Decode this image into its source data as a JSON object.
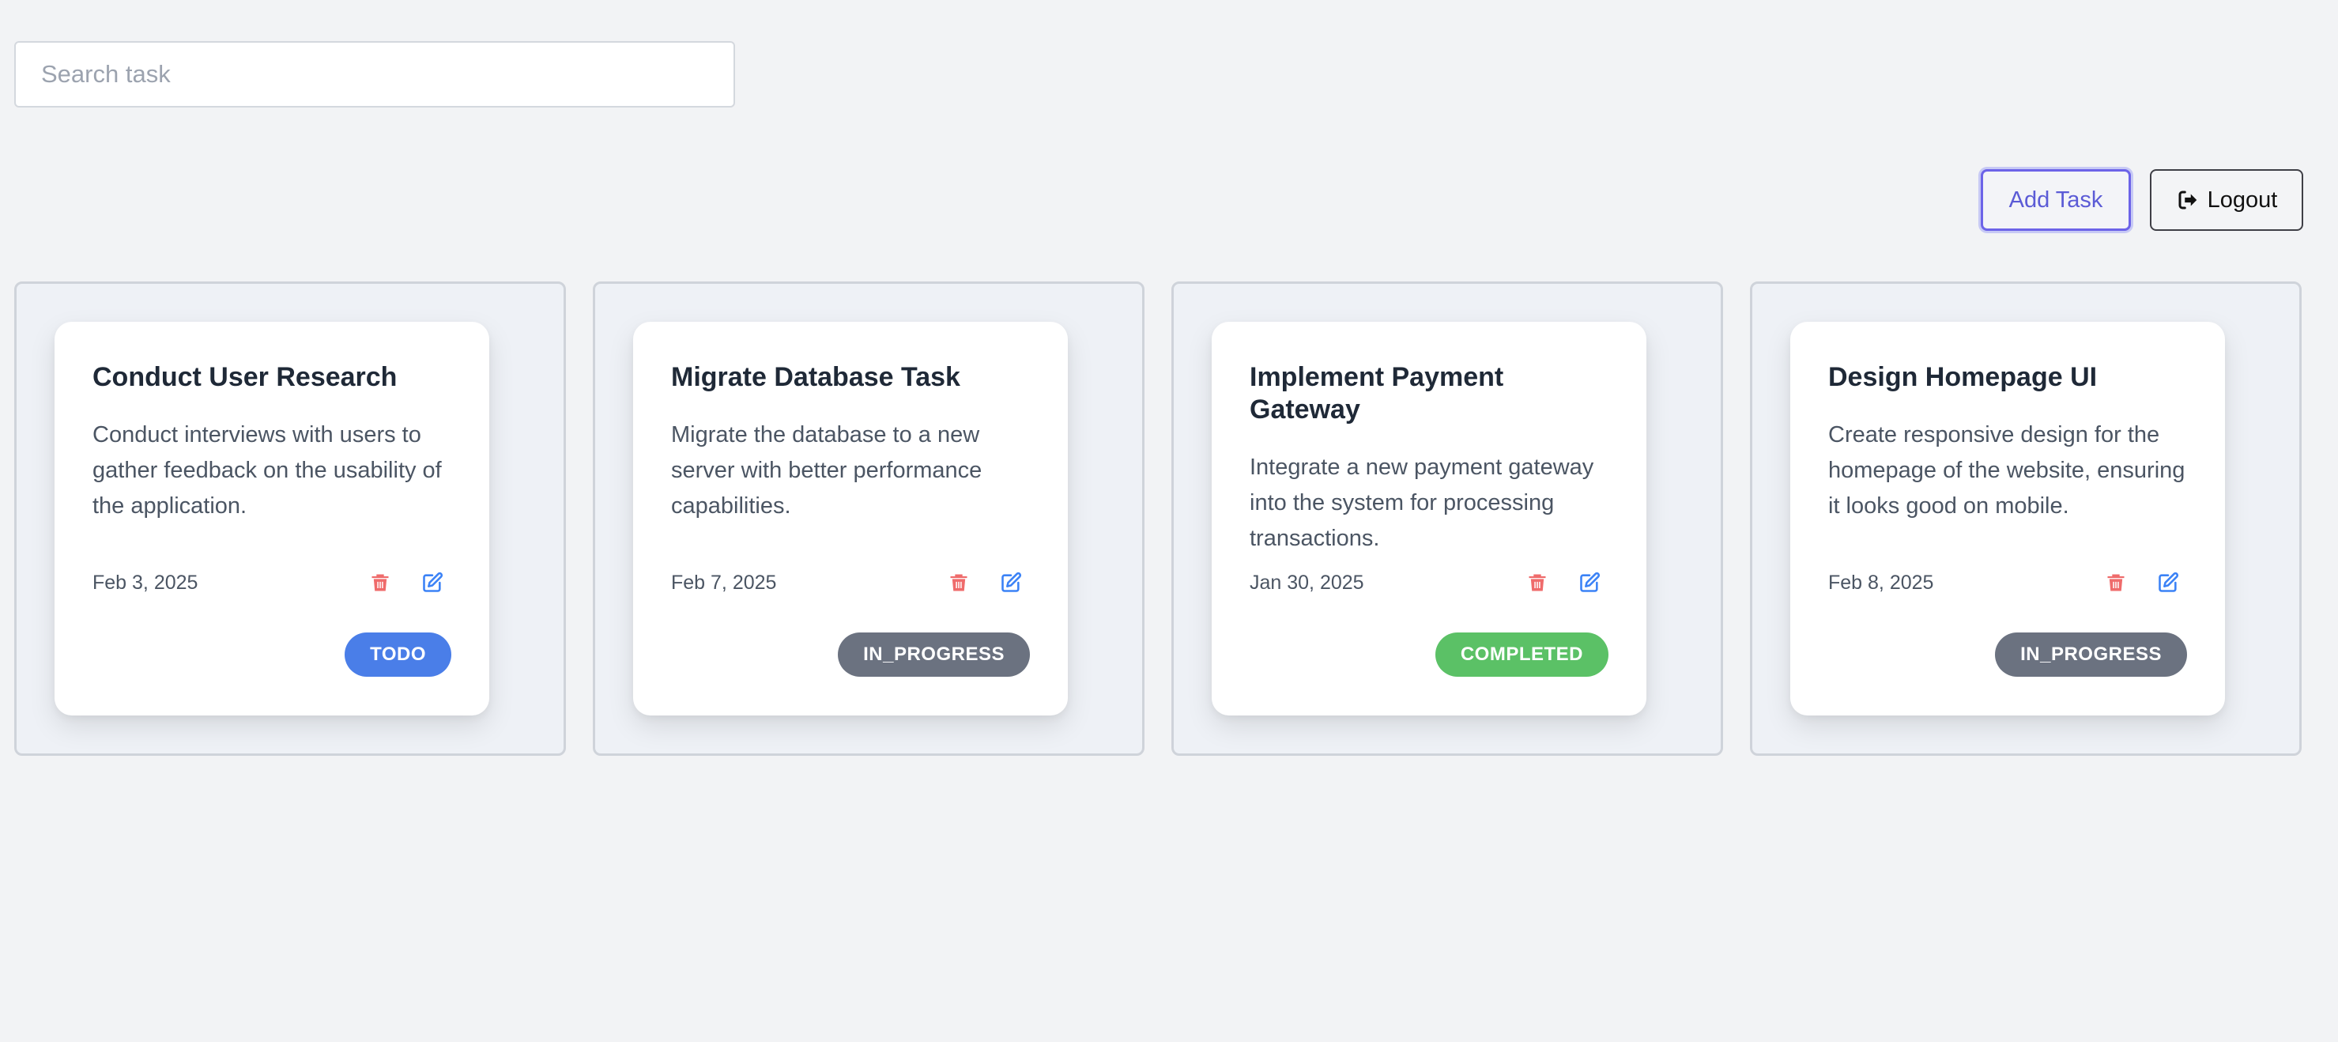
{
  "search": {
    "placeholder": "Search task",
    "value": ""
  },
  "toolbar": {
    "add_label": "Add Task",
    "logout_label": "Logout"
  },
  "status_colors": {
    "TODO": "#4a7ee8",
    "IN_PROGRESS": "#6b7280",
    "COMPLETED": "#5bc166"
  },
  "tasks": [
    {
      "title": "Conduct User Research",
      "description": "Conduct interviews with users to gather feedback on the usability of the application.",
      "date": "Feb 3, 2025",
      "status": "TODO"
    },
    {
      "title": "Migrate Database Task",
      "description": "Migrate the database to a new server with better performance capabilities.",
      "date": "Feb 7, 2025",
      "status": "IN_PROGRESS"
    },
    {
      "title": "Implement Payment Gateway",
      "description": "Integrate a new payment gateway into the system for processing transactions.",
      "date": "Jan 30, 2025",
      "status": "COMPLETED"
    },
    {
      "title": "Design Homepage UI",
      "description": "Create responsive design for the homepage of the website, ensuring it looks good on mobile.",
      "date": "Feb 8, 2025",
      "status": "IN_PROGRESS"
    }
  ],
  "icons": {
    "delete": "trash-icon",
    "edit": "edit-icon",
    "logout": "sign-out-icon"
  }
}
